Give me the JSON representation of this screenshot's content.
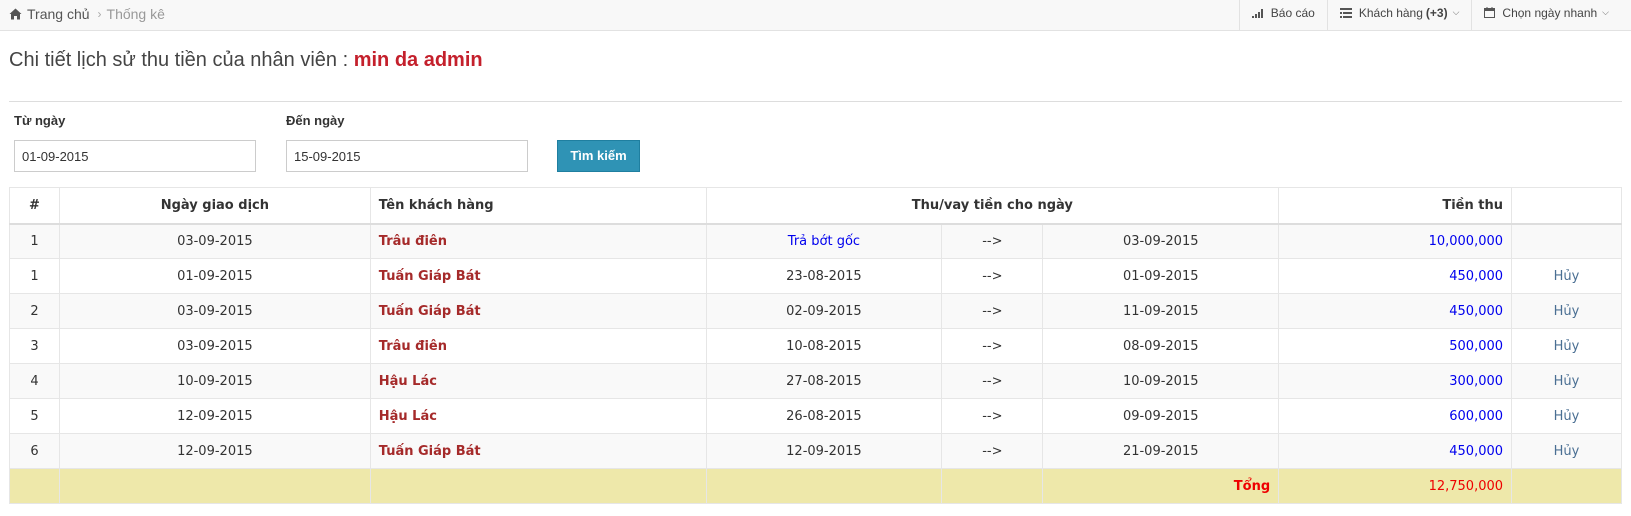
{
  "breadcrumb": {
    "home": "Trang chủ",
    "current": "Thống kê"
  },
  "topnav": {
    "report": "Báo cáo",
    "customers_label": "Khách hàng",
    "customers_count": "(+3)",
    "quick_date": "Chọn ngày nhanh"
  },
  "title": {
    "prefix": "Chi tiết lịch sử thu tiền của nhân viên :",
    "staff": "min da admin"
  },
  "filter": {
    "from_label": "Từ ngày",
    "from_value": "01-09-2015",
    "to_label": "Đến ngày",
    "to_value": "15-09-2015",
    "search_button": "Tìm kiếm"
  },
  "table": {
    "headers": {
      "index": "#",
      "date": "Ngày giao dịch",
      "customer": "Tên khách hàng",
      "period": "Thu/vay tiền cho ngày",
      "amount": "Tiền thu"
    },
    "rows": [
      {
        "index": "1",
        "date": "03-09-2015",
        "customer": "Trâu điên",
        "from": "Trả bớt gốc",
        "arrow": "-->",
        "to": "03-09-2015",
        "amount": "10,000,000",
        "action": ""
      },
      {
        "index": "1",
        "date": "01-09-2015",
        "customer": "Tuấn Giáp Bát",
        "from": "23-08-2015",
        "arrow": "-->",
        "to": "01-09-2015",
        "amount": "450,000",
        "action": "Hủy"
      },
      {
        "index": "2",
        "date": "03-09-2015",
        "customer": "Tuấn Giáp Bát",
        "from": "02-09-2015",
        "arrow": "-->",
        "to": "11-09-2015",
        "amount": "450,000",
        "action": "Hủy"
      },
      {
        "index": "3",
        "date": "03-09-2015",
        "customer": "Trâu điên",
        "from": "10-08-2015",
        "arrow": "-->",
        "to": "08-09-2015",
        "amount": "500,000",
        "action": "Hủy"
      },
      {
        "index": "4",
        "date": "10-09-2015",
        "customer": "Hậu Lác",
        "from": "27-08-2015",
        "arrow": "-->",
        "to": "10-09-2015",
        "amount": "300,000",
        "action": "Hủy"
      },
      {
        "index": "5",
        "date": "12-09-2015",
        "customer": "Hậu Lác",
        "from": "26-08-2015",
        "arrow": "-->",
        "to": "09-09-2015",
        "amount": "600,000",
        "action": "Hủy"
      },
      {
        "index": "6",
        "date": "12-09-2015",
        "customer": "Tuấn Giáp Bát",
        "from": "12-09-2015",
        "arrow": "-->",
        "to": "21-09-2015",
        "amount": "450,000",
        "action": "Hủy"
      }
    ],
    "total": {
      "label": "Tổng",
      "amount": "12,750,000"
    }
  },
  "colors": {
    "accent": "#2f93b5",
    "staff_name": "#c4202c",
    "customer": "#a52a2a",
    "money": "#0000ee",
    "total_row": "#eee8aa",
    "total_text": "#ee0000"
  },
  "icons": {
    "home": "home-icon",
    "report": "signal-bars-icon",
    "customers": "list-icon",
    "quick_date": "calendar-icon"
  }
}
